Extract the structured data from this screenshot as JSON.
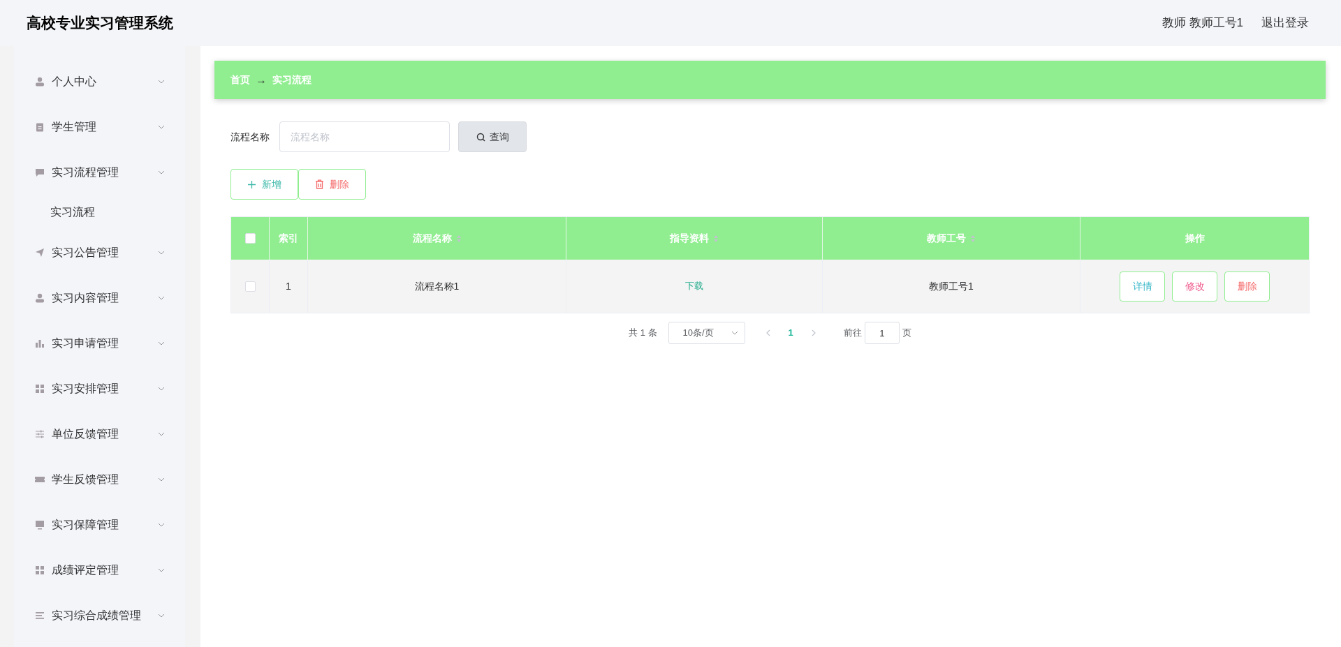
{
  "header": {
    "title": "高校专业实习管理系统",
    "user": "教师 教师工号1",
    "logout": "退出登录"
  },
  "sidebar": {
    "items": [
      {
        "label": "个人中心"
      },
      {
        "label": "学生管理"
      },
      {
        "label": "实习流程管理",
        "children": [
          {
            "label": "实习流程"
          }
        ]
      },
      {
        "label": "实习公告管理"
      },
      {
        "label": "实习内容管理"
      },
      {
        "label": "实习申请管理"
      },
      {
        "label": "实习安排管理"
      },
      {
        "label": "单位反馈管理"
      },
      {
        "label": "学生反馈管理"
      },
      {
        "label": "实习保障管理"
      },
      {
        "label": "成绩评定管理"
      },
      {
        "label": "实习综合成绩管理"
      }
    ]
  },
  "breadcrumb": [
    "首页",
    "实习流程"
  ],
  "breadcrumb_separator": "→",
  "search": {
    "label": "流程名称",
    "placeholder": "流程名称",
    "button": "查询"
  },
  "actions": [
    {
      "label": "新增",
      "kind": "add"
    },
    {
      "label": "删除",
      "kind": "delete"
    }
  ],
  "table": {
    "columns": [
      {
        "label": "索引",
        "sortable": false
      },
      {
        "label": "流程名称",
        "sortable": true
      },
      {
        "label": "指导资料",
        "sortable": true
      },
      {
        "label": "教师工号",
        "sortable": true
      },
      {
        "label": "操作",
        "sortable": false
      }
    ],
    "all_checked": false,
    "rows": [
      {
        "checked": false,
        "index": "1",
        "name": "流程名称1",
        "material": "下载",
        "teacher": "教师工号1",
        "buttons": [
          {
            "label": "详情",
            "kind": "detail"
          },
          {
            "label": "修改",
            "kind": "edit"
          },
          {
            "label": "删除",
            "kind": "delete"
          }
        ]
      }
    ]
  },
  "pagination": {
    "total": "共 1 条",
    "page_size": "10条/页",
    "pages": [
      {
        "label": "1",
        "selected": true
      }
    ],
    "goto_label": "前往",
    "goto_value": "1",
    "page_suffix": "页"
  }
}
